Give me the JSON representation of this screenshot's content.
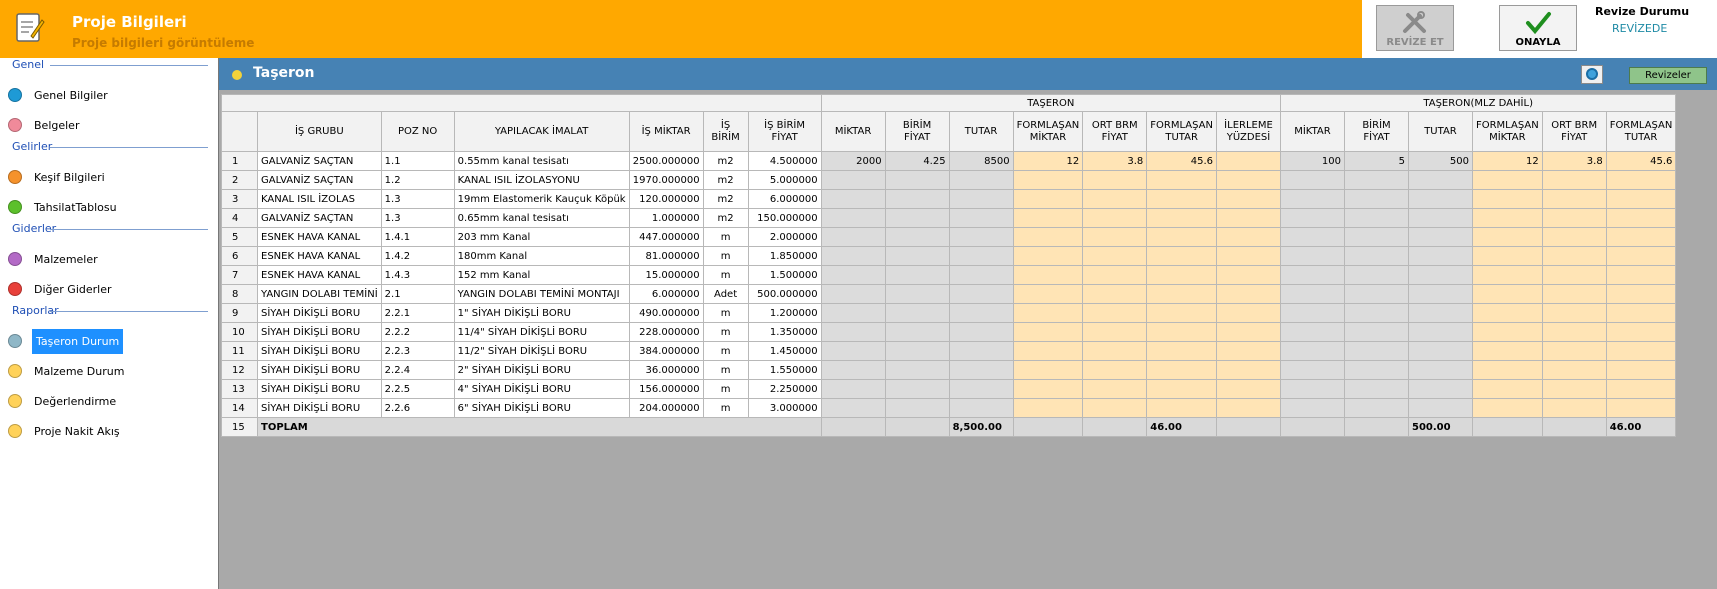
{
  "header": {
    "title": "Proje Bilgileri",
    "subtitle": "Proje bilgileri görüntüleme",
    "revize_et_label": "REVİZE ET",
    "onayla_label": "ONAYLA",
    "revize_durumu_label": "Revize Durumu",
    "revize_durumu_value": "REVİZEDE"
  },
  "sidebar": {
    "sections": [
      {
        "title": "Genel",
        "items": [
          {
            "label": "Genel Bilgiler",
            "color": "#1e9ad6"
          },
          {
            "label": "Belgeler",
            "color": "#f08a9a"
          }
        ]
      },
      {
        "title": "Gelirler",
        "items": [
          {
            "label": "Keşif Bilgileri",
            "color": "#f5922b"
          },
          {
            "label": "TahsilatTablosu",
            "color": "#5cc02b"
          }
        ]
      },
      {
        "title": "Giderler",
        "items": [
          {
            "label": "Malzemeler",
            "color": "#b36ac6"
          },
          {
            "label": "Diğer Giderler",
            "color": "#e8403a"
          }
        ]
      },
      {
        "title": "Raporlar",
        "items": [
          {
            "label": "Taşeron Durum",
            "color": "#8fb7c7",
            "active": true
          },
          {
            "label": "Malzeme Durum",
            "color": "#ffd25a"
          },
          {
            "label": "Değerlendirme",
            "color": "#ffd25a"
          },
          {
            "label": "Proje Nakit Akış",
            "color": "#ffd25a"
          }
        ]
      }
    ]
  },
  "main": {
    "section_title": "Taşeron",
    "revizeler_label": "Revizeler"
  },
  "grid": {
    "group_headers": {
      "taseron": "TAŞERON",
      "taseron_mlz": "TAŞERON(MLZ DAHİL)"
    },
    "columns": [
      "İŞ GRUBU",
      "POZ NO",
      "YAPILACAK İMALAT",
      "İŞ MİKTAR",
      "İŞ BİRİM",
      "İŞ BİRİM FİYAT",
      "MİKTAR",
      "BİRİM FİYAT",
      "TUTAR",
      "FORMLAŞAN MİKTAR",
      "ORT BRM FİYAT",
      "FORMLAŞAN TUTAR",
      "İLERLEME YÜZDESİ",
      "MİKTAR",
      "BİRİM FİYAT",
      "TUTAR",
      "FORMLAŞAN MİKTAR",
      "ORT BRM FİYAT",
      "FORMLAŞAN TUTAR"
    ],
    "rows": [
      {
        "no": "1",
        "grup": "GALVANİZ SAÇTAN",
        "poz": "1.1",
        "imalat": "0.55mm kanal tesisatı",
        "miktar": "2500.000000",
        "birim": "m2",
        "fiyat": "4.500000",
        "t": [
          "2000",
          "4.25",
          "8500",
          "12",
          "3.8",
          "45.6",
          ""
        ],
        "m": [
          "100",
          "5",
          "500",
          "12",
          "3.8",
          "45.6"
        ]
      },
      {
        "no": "2",
        "grup": "GALVANİZ SAÇTAN",
        "poz": "1.2",
        "imalat": " KANAL ISIL  İZOLASYONU",
        "miktar": "1970.000000",
        "birim": "m2",
        "fiyat": "5.000000"
      },
      {
        "no": "3",
        "grup": "KANAL ISIL  İZOLAS",
        "poz": "1.3",
        "imalat": "19mm Elastomerik Kauçuk Köpük",
        "miktar": "120.000000",
        "birim": "m2",
        "fiyat": "6.000000"
      },
      {
        "no": "4",
        "grup": "GALVANİZ SAÇTAN",
        "poz": "1.3",
        "imalat": "0.65mm kanal tesisatı",
        "miktar": "1.000000",
        "birim": "m2",
        "fiyat": "150.000000"
      },
      {
        "no": "5",
        "grup": "ESNEK HAVA KANAL",
        "poz": "1.4.1",
        "imalat": "203 mm Kanal",
        "miktar": "447.000000",
        "birim": "m",
        "fiyat": "2.000000"
      },
      {
        "no": "6",
        "grup": "ESNEK HAVA KANAL",
        "poz": "1.4.2",
        "imalat": "180mm Kanal",
        "miktar": "81.000000",
        "birim": "m",
        "fiyat": "1.850000"
      },
      {
        "no": "7",
        "grup": "ESNEK HAVA KANAL",
        "poz": "1.4.3",
        "imalat": "152 mm Kanal",
        "miktar": "15.000000",
        "birim": "m",
        "fiyat": "1.500000"
      },
      {
        "no": "8",
        "grup": "YANGIN DOLABI TEMİNİ",
        "poz": "2.1",
        "imalat": "YANGIN DOLABI TEMİNİ MONTAJI",
        "miktar": "6.000000",
        "birim": "Adet",
        "fiyat": "500.000000"
      },
      {
        "no": "9",
        "grup": "SİYAH DİKİŞLİ BORU",
        "poz": "2.2.1",
        "imalat": "1\" SİYAH DİKİŞLİ BORU",
        "miktar": "490.000000",
        "birim": "m",
        "fiyat": "1.200000"
      },
      {
        "no": "10",
        "grup": "SİYAH DİKİŞLİ BORU",
        "poz": "2.2.2",
        "imalat": "11/4\" SİYAH DİKİŞLİ BORU",
        "miktar": "228.000000",
        "birim": "m",
        "fiyat": "1.350000"
      },
      {
        "no": "11",
        "grup": "SİYAH DİKİŞLİ BORU",
        "poz": "2.2.3",
        "imalat": "11/2\" SİYAH DİKİŞLİ BORU",
        "miktar": "384.000000",
        "birim": "m",
        "fiyat": "1.450000"
      },
      {
        "no": "12",
        "grup": "SİYAH DİKİŞLİ BORU",
        "poz": "2.2.4",
        "imalat": "2\" SİYAH DİKİŞLİ BORU",
        "miktar": "36.000000",
        "birim": "m",
        "fiyat": "1.550000"
      },
      {
        "no": "13",
        "grup": "SİYAH DİKİŞLİ BORU",
        "poz": "2.2.5",
        "imalat": "4\" SİYAH DİKİŞLİ BORU",
        "miktar": "156.000000",
        "birim": "m",
        "fiyat": "2.250000"
      },
      {
        "no": "14",
        "grup": "SİYAH DİKİŞLİ BORU",
        "poz": "2.2.6",
        "imalat": "6\" SİYAH DİKİŞLİ BORU",
        "miktar": "204.000000",
        "birim": "m",
        "fiyat": "3.000000"
      }
    ],
    "total": {
      "no": "15",
      "label": "TOPLAM",
      "t_tutar": "8,500.00",
      "t_form_tutar": "46.00",
      "m_tutar": "500.00",
      "m_form_tutar": "46.00"
    }
  },
  "colors": {
    "header": "#ffa800",
    "section_bar": "#4682b4",
    "gray_cell": "#dcdcdc",
    "orange_cell": "#ffe4b5",
    "active_nav": "#1e90ff"
  }
}
